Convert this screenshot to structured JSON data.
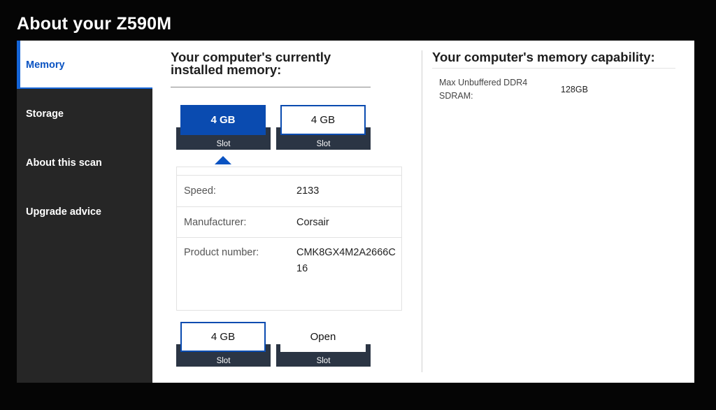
{
  "title": "About your Z590M",
  "sidebar": {
    "items": [
      {
        "label": "Memory",
        "active": true
      },
      {
        "label": "Storage"
      },
      {
        "label": "About this scan"
      },
      {
        "label": "Upgrade advice"
      }
    ]
  },
  "installed": {
    "heading": "Your computer's currently installed memory:",
    "slots": [
      {
        "size": "4 GB",
        "label": "Slot",
        "state": "selected"
      },
      {
        "size": "4 GB",
        "label": "Slot",
        "state": "installed"
      },
      {
        "size": "4 GB",
        "label": "Slot",
        "state": "installed"
      },
      {
        "size": "Open",
        "label": "Slot",
        "state": "open"
      }
    ],
    "details": [
      {
        "label": "Speed:",
        "value": "2133"
      },
      {
        "label": "Manufacturer:",
        "value": "Corsair"
      },
      {
        "label": "Product number:",
        "value": "CMK8GX4M2A2666C16"
      }
    ]
  },
  "capability": {
    "heading": "Your computer's memory capability:",
    "rows": [
      {
        "label": "Max Unbuffered DDR4 SDRAM:",
        "value": "128GB"
      }
    ]
  },
  "colors": {
    "accent": "#0a4bb0",
    "slot_base": "#2b3544",
    "sidebar_bg": "#262626",
    "page_bg": "#050505"
  }
}
